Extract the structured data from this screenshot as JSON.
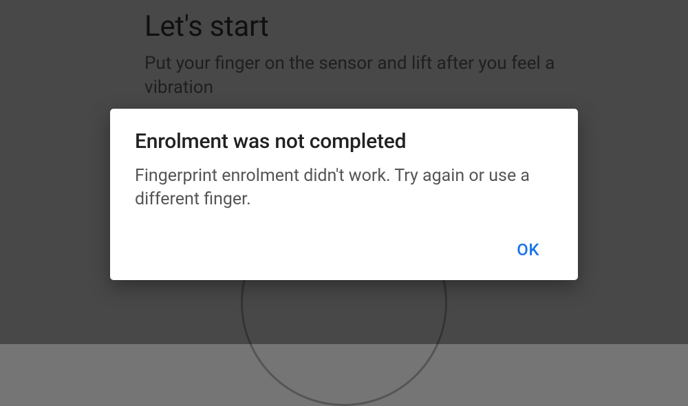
{
  "background": {
    "title": "Let's start",
    "subtitle": "Put your finger on the sensor and lift after you feel a vibration"
  },
  "dialog": {
    "title": "Enrolment was not completed",
    "message": "Fingerprint enrolment didn't work. Try again or use a different finger.",
    "ok_label": "OK"
  },
  "colors": {
    "accent": "#1a73e8",
    "dialog_bg": "#ffffff",
    "scrim": "rgba(0,0,0,0.38)"
  }
}
